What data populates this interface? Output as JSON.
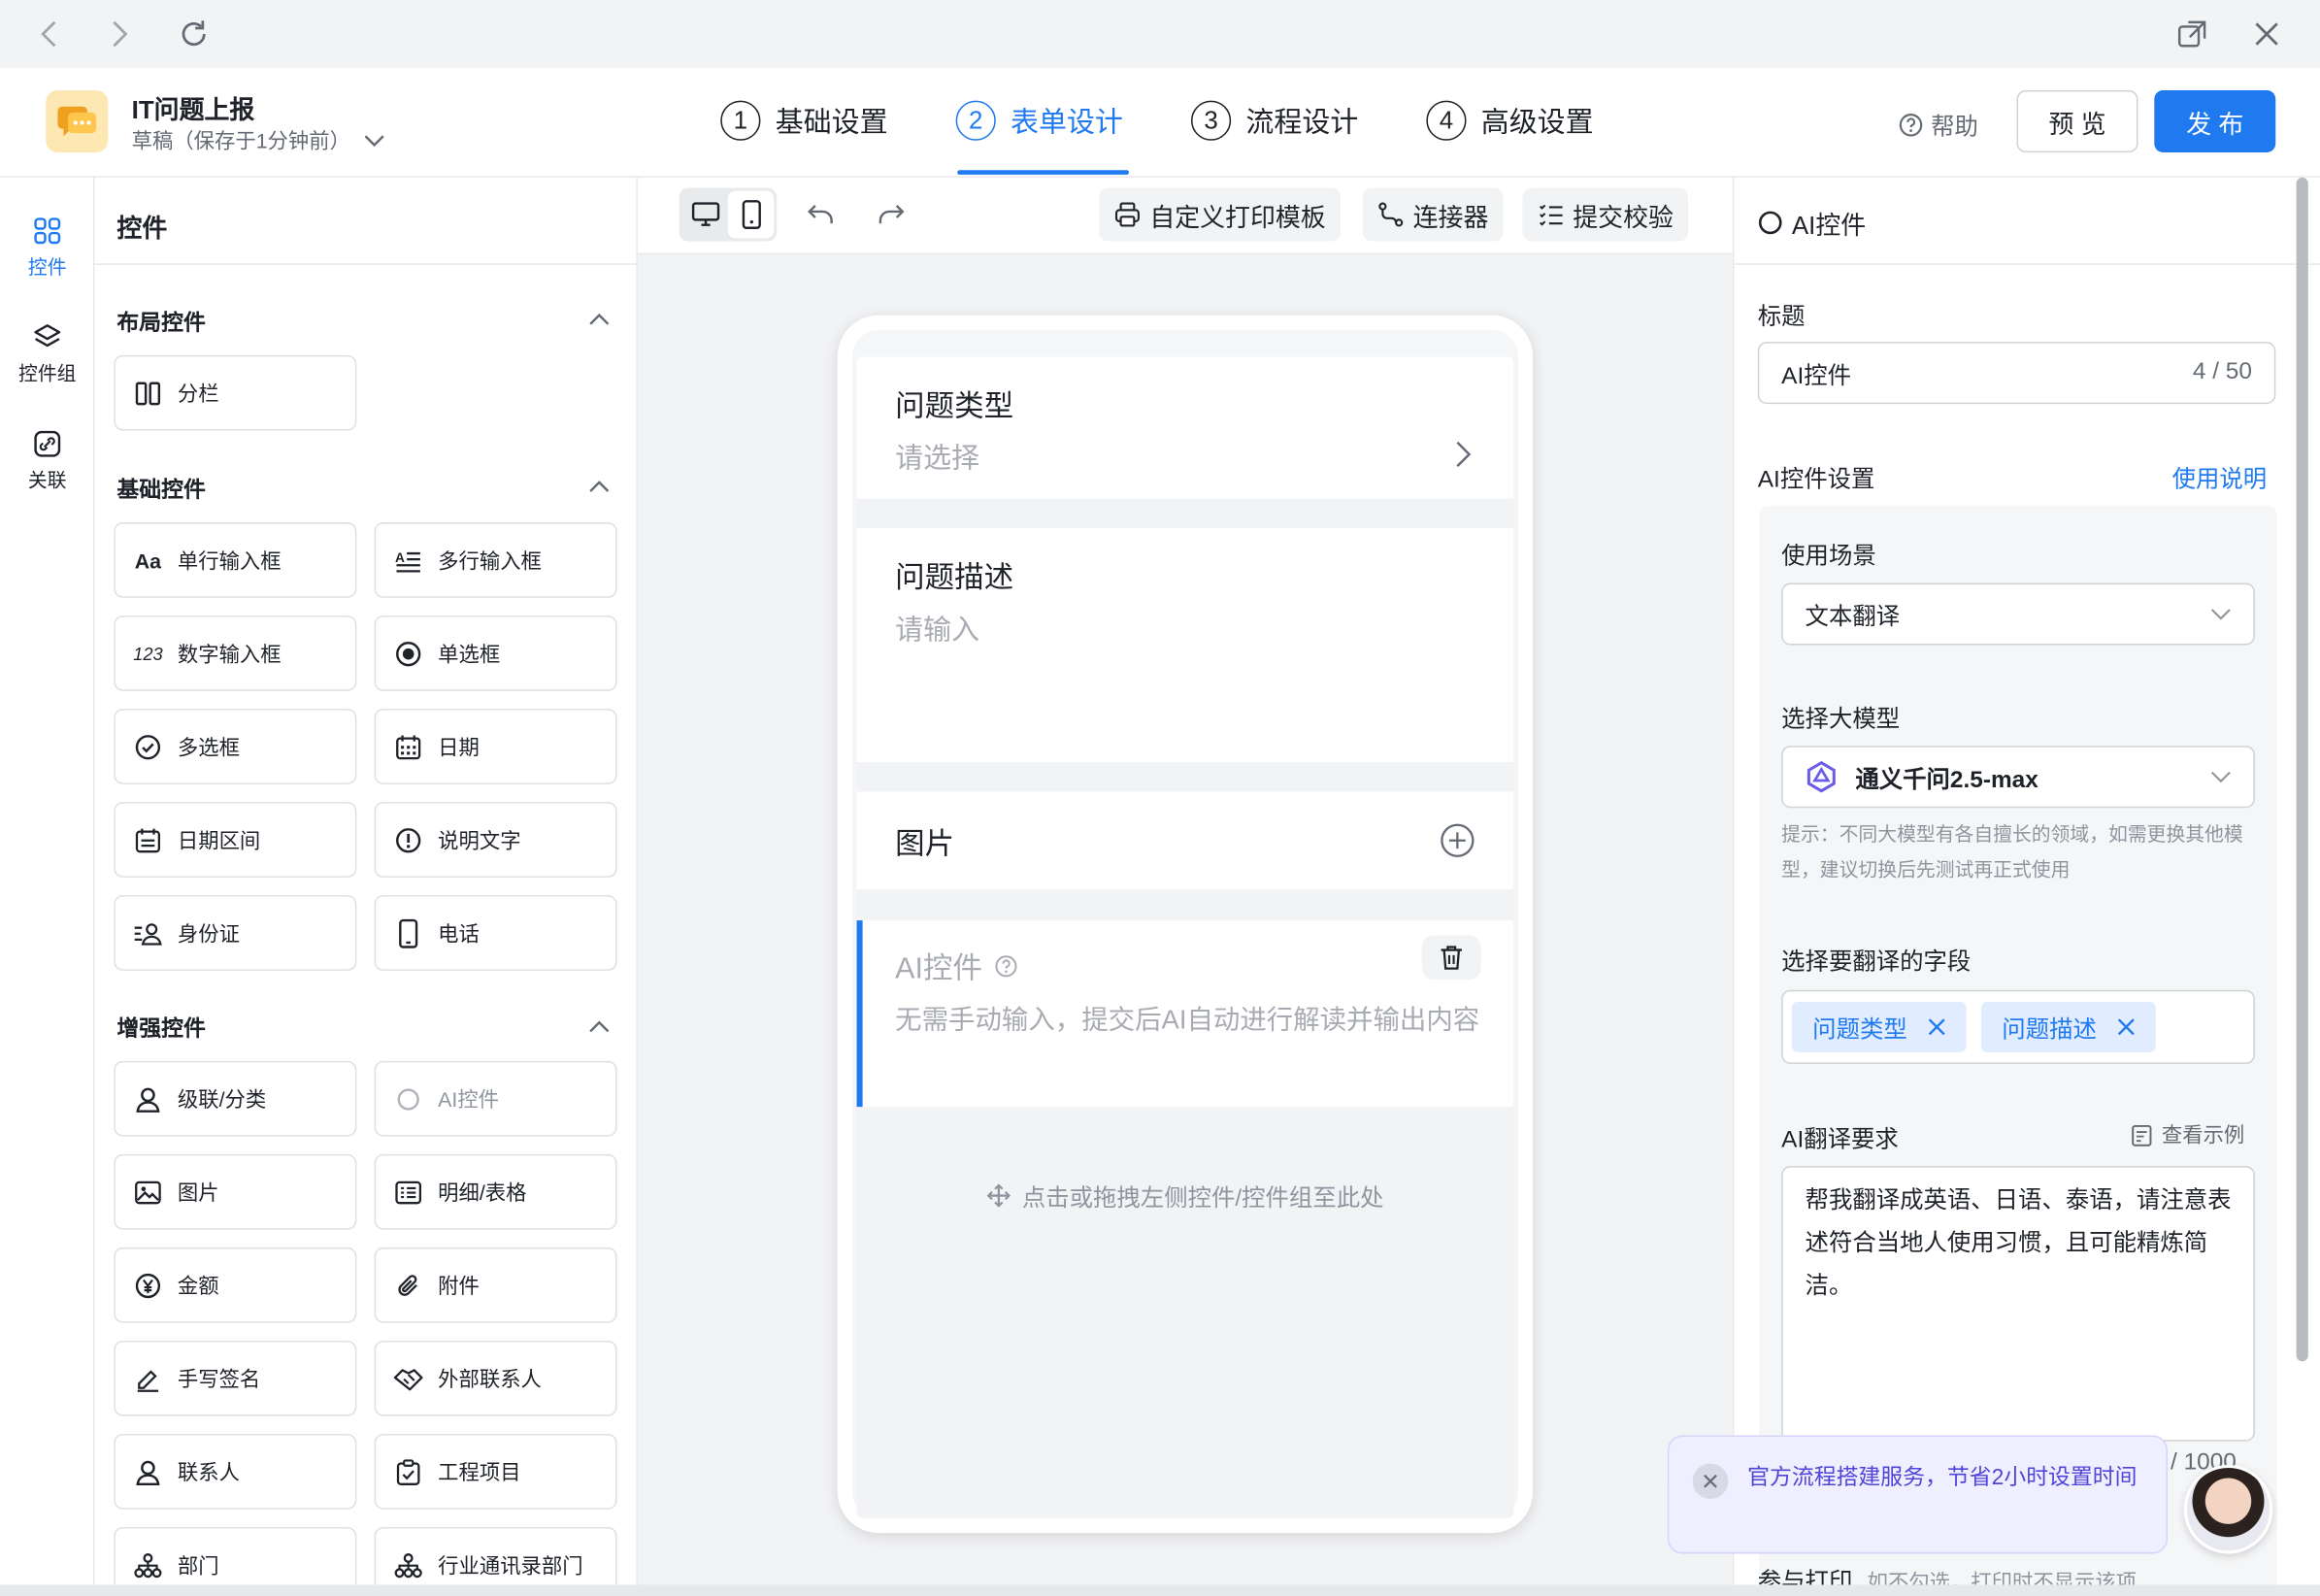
{
  "header": {
    "app_title": "IT问题上报",
    "app_subtitle": "草稿（保存于1分钟前）",
    "steps": [
      {
        "num": "1",
        "label": "基础设置"
      },
      {
        "num": "2",
        "label": "表单设计"
      },
      {
        "num": "3",
        "label": "流程设计"
      },
      {
        "num": "4",
        "label": "高级设置"
      }
    ],
    "active_step": "表单设计",
    "help": "帮助",
    "preview": "预 览",
    "publish": "发 布"
  },
  "rail": [
    {
      "label": "控件",
      "icon": "grid-icon"
    },
    {
      "label": "控件组",
      "icon": "layers-icon"
    },
    {
      "label": "关联",
      "icon": "link-icon"
    }
  ],
  "panel": {
    "title": "控件",
    "groups": [
      {
        "title": "布局控件",
        "items": [
          {
            "label": "分栏",
            "icon": "columns-icon"
          }
        ]
      },
      {
        "title": "基础控件",
        "items": [
          {
            "label": "单行输入框",
            "icon": "text-input-icon"
          },
          {
            "label": "多行输入框",
            "icon": "multiline-icon"
          },
          {
            "label": "数字输入框",
            "icon": "number-icon"
          },
          {
            "label": "单选框",
            "icon": "radio-icon"
          },
          {
            "label": "多选框",
            "icon": "checkbox-icon"
          },
          {
            "label": "日期",
            "icon": "calendar-icon"
          },
          {
            "label": "日期区间",
            "icon": "date-range-icon"
          },
          {
            "label": "说明文字",
            "icon": "info-icon"
          },
          {
            "label": "身份证",
            "icon": "id-card-icon"
          },
          {
            "label": "电话",
            "icon": "phone-icon"
          }
        ]
      },
      {
        "title": "增强控件",
        "items": [
          {
            "label": "级联/分类",
            "icon": "person-icon"
          },
          {
            "label": "AI控件",
            "icon": "ai-icon"
          },
          {
            "label": "图片",
            "icon": "image-icon"
          },
          {
            "label": "明细/表格",
            "icon": "table-icon"
          },
          {
            "label": "金额",
            "icon": "yuan-icon"
          },
          {
            "label": "附件",
            "icon": "paperclip-icon"
          },
          {
            "label": "手写签名",
            "icon": "signature-icon"
          },
          {
            "label": "外部联系人",
            "icon": "handshake-icon"
          },
          {
            "label": "联系人",
            "icon": "contact-icon"
          },
          {
            "label": "工程项目",
            "icon": "clipboard-icon"
          },
          {
            "label": "部门",
            "icon": "org-icon"
          },
          {
            "label": "行业通讯录部门",
            "icon": "org-tree-icon"
          }
        ]
      }
    ]
  },
  "toolbar": {
    "print_template": "自定义打印模板",
    "connector": "连接器",
    "submit_check": "提交校验"
  },
  "form": {
    "fields": [
      {
        "label": "问题类型",
        "placeholder": "请选择"
      },
      {
        "label": "问题描述",
        "placeholder": "请输入"
      },
      {
        "label": "图片"
      }
    ],
    "ai_field": {
      "label": "AI控件",
      "placeholder": "无需手动输入，提交后AI自动进行解读并输出内容"
    },
    "drop_hint": "点击或拖拽左侧控件/控件组至此处"
  },
  "props": {
    "head": "AI控件",
    "title_label": "标题",
    "title_value": "AI控件",
    "title_count": "4 / 50",
    "ai_settings_label": "AI控件设置",
    "usage_link": "使用说明",
    "scene_label": "使用场景",
    "scene_value": "文本翻译",
    "model_label": "选择大模型",
    "model_value": "通义千问2.5-max",
    "model_hint": "提示：不同大模型有各自擅长的领域，如需更换其他模型，建议切换后先测试再正式使用",
    "fields_label": "选择要翻译的字段",
    "field_tags": [
      "问题类型",
      "问题描述"
    ],
    "requirement_label": "AI翻译要求",
    "example_link": "查看示例",
    "requirement_text": "帮我翻译成英语、日语、泰语，请注意表述符合当地人使用习惯，且可能精炼简洁。",
    "requirement_count": "/ 1000",
    "print_label": "参与打印",
    "print_hint": "如不勾选，打印时不显示该项"
  },
  "toast": {
    "text": "官方流程搭建服务，节省2小时设置时间"
  },
  "colors": {
    "accent": "#1f7af0",
    "toast_text": "#4f45d9"
  }
}
